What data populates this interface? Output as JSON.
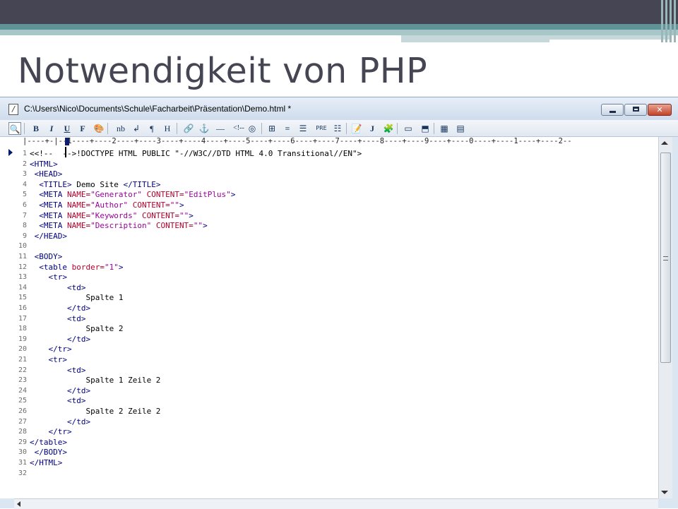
{
  "slide": {
    "title": "Notwendigkeit von PHP"
  },
  "window": {
    "title": "C:\\Users\\Nico\\Documents\\Schule\\Facharbeit\\Präsentation\\Demo.html *",
    "buttons": {
      "minimize": "minimize",
      "maximize": "maximize",
      "close": "✕"
    }
  },
  "toolbar": {
    "items": [
      {
        "name": "browser-preview-button",
        "label": "🔍",
        "icon": "preview-icon"
      },
      {
        "name": "bold-button",
        "label": "B"
      },
      {
        "name": "italic-button",
        "label": "I"
      },
      {
        "name": "underline-button",
        "label": "U"
      },
      {
        "name": "font-button",
        "label": "F"
      },
      {
        "name": "color-button",
        "label": "🎨",
        "icon": "palette-icon"
      },
      {
        "name": "nbsp-button",
        "label": "nb"
      },
      {
        "name": "line-break-button",
        "label": "↲"
      },
      {
        "name": "paragraph-button",
        "label": "¶"
      },
      {
        "name": "heading-button",
        "label": "H"
      },
      {
        "name": "link-button",
        "label": "🔗",
        "icon": "link-icon"
      },
      {
        "name": "anchor-button",
        "label": "⚓",
        "icon": "anchor-icon"
      },
      {
        "name": "horizontal-rule-button",
        "label": "—"
      },
      {
        "name": "comment-button",
        "label": "<!--"
      },
      {
        "name": "image-button",
        "label": "◎",
        "icon": "image-icon"
      },
      {
        "name": "table-button",
        "label": "⊞",
        "icon": "table-icon"
      },
      {
        "name": "center-button",
        "label": "≡",
        "icon": "align-center-icon"
      },
      {
        "name": "align-button",
        "label": "☰",
        "icon": "align-icon"
      },
      {
        "name": "pre-button",
        "label": "PRE"
      },
      {
        "name": "list-button",
        "label": "☷",
        "icon": "list-icon"
      },
      {
        "name": "form-button",
        "label": "📝",
        "icon": "form-icon"
      },
      {
        "name": "javascript-button",
        "label": "J"
      },
      {
        "name": "script-button",
        "label": "🧩",
        "icon": "script-icon"
      },
      {
        "name": "frame-button",
        "label": "▭",
        "icon": "frame-icon"
      },
      {
        "name": "frameset-button",
        "label": "⬒",
        "icon": "frameset-icon"
      },
      {
        "name": "color-picker-button",
        "label": "▦",
        "icon": "color-grid-icon"
      },
      {
        "name": "layout-button",
        "label": "▤",
        "icon": "layout-icon"
      }
    ]
  },
  "ruler": {
    "text": "|----+-|--1----+----2----+----3----+----4----+----5----+----6----+----7----+----8----+----9----+----0----+----1----+----2--"
  },
  "editor": {
    "lines": [
      {
        "n": "1",
        "parts": [
          [
            "txt",
            "<<!-- "
          ],
          [
            "txt",
            " -->!DOCTYPE HTML PUBLIC \"-//W3C//DTD HTML 4.0 Transitional//EN\">"
          ]
        ]
      },
      {
        "n": "2",
        "parts": [
          [
            "tag",
            "<HTML>"
          ]
        ]
      },
      {
        "n": "3",
        "parts": [
          [
            "tag",
            " <HEAD>"
          ]
        ]
      },
      {
        "n": "4",
        "parts": [
          [
            "tag",
            "  <TITLE>"
          ],
          [
            "txt",
            " Demo Site "
          ],
          [
            "tag",
            "</TITLE>"
          ]
        ]
      },
      {
        "n": "5",
        "parts": [
          [
            "tag",
            "  <META "
          ],
          [
            "attr",
            "NAME="
          ],
          [
            "val",
            "\"Generator\""
          ],
          [
            "attr",
            " CONTENT="
          ],
          [
            "val",
            "\"EditPlus\""
          ],
          [
            "tag",
            ">"
          ]
        ]
      },
      {
        "n": "6",
        "parts": [
          [
            "tag",
            "  <META "
          ],
          [
            "attr",
            "NAME="
          ],
          [
            "val",
            "\"Author\""
          ],
          [
            "attr",
            " CONTENT="
          ],
          [
            "val",
            "\"\""
          ],
          [
            "tag",
            ">"
          ]
        ]
      },
      {
        "n": "7",
        "parts": [
          [
            "tag",
            "  <META "
          ],
          [
            "attr",
            "NAME="
          ],
          [
            "val",
            "\"Keywords\""
          ],
          [
            "attr",
            " CONTENT="
          ],
          [
            "val",
            "\"\""
          ],
          [
            "tag",
            ">"
          ]
        ]
      },
      {
        "n": "8",
        "parts": [
          [
            "tag",
            "  <META "
          ],
          [
            "attr",
            "NAME="
          ],
          [
            "val",
            "\"Description\""
          ],
          [
            "attr",
            " CONTENT="
          ],
          [
            "val",
            "\"\""
          ],
          [
            "tag",
            ">"
          ]
        ]
      },
      {
        "n": "9",
        "parts": [
          [
            "tag",
            " </HEAD>"
          ]
        ]
      },
      {
        "n": "10",
        "parts": []
      },
      {
        "n": "11",
        "parts": [
          [
            "tag",
            " <BODY>"
          ]
        ]
      },
      {
        "n": "12",
        "parts": [
          [
            "tag",
            "  <table "
          ],
          [
            "attr",
            "border="
          ],
          [
            "val",
            "\"1\""
          ],
          [
            "tag",
            ">"
          ]
        ]
      },
      {
        "n": "13",
        "parts": [
          [
            "tag",
            "    <tr>"
          ]
        ]
      },
      {
        "n": "14",
        "parts": [
          [
            "tag",
            "        <td>"
          ]
        ]
      },
      {
        "n": "15",
        "parts": [
          [
            "txt",
            "            Spalte 1"
          ]
        ]
      },
      {
        "n": "16",
        "parts": [
          [
            "tag",
            "        </td>"
          ]
        ]
      },
      {
        "n": "17",
        "parts": [
          [
            "tag",
            "        <td>"
          ]
        ]
      },
      {
        "n": "18",
        "parts": [
          [
            "txt",
            "            Spalte 2"
          ]
        ]
      },
      {
        "n": "19",
        "parts": [
          [
            "tag",
            "        </td>"
          ]
        ]
      },
      {
        "n": "20",
        "parts": [
          [
            "tag",
            "    </tr>"
          ]
        ]
      },
      {
        "n": "21",
        "parts": [
          [
            "tag",
            "    <tr>"
          ]
        ]
      },
      {
        "n": "22",
        "parts": [
          [
            "tag",
            "        <td>"
          ]
        ]
      },
      {
        "n": "23",
        "parts": [
          [
            "txt",
            "            Spalte 1 Zeile 2"
          ]
        ]
      },
      {
        "n": "24",
        "parts": [
          [
            "tag",
            "        </td>"
          ]
        ]
      },
      {
        "n": "25",
        "parts": [
          [
            "tag",
            "        <td>"
          ]
        ]
      },
      {
        "n": "26",
        "parts": [
          [
            "txt",
            "            Spalte 2 Zeile 2"
          ]
        ]
      },
      {
        "n": "27",
        "parts": [
          [
            "tag",
            "        </td>"
          ]
        ]
      },
      {
        "n": "28",
        "parts": [
          [
            "tag",
            "    </tr>"
          ]
        ]
      },
      {
        "n": "29",
        "parts": [
          [
            "tag",
            "</table>"
          ]
        ]
      },
      {
        "n": "30",
        "parts": [
          [
            "tag",
            " </BODY>"
          ]
        ]
      },
      {
        "n": "31",
        "parts": [
          [
            "tag",
            "</HTML>"
          ]
        ]
      },
      {
        "n": "32",
        "parts": []
      }
    ]
  },
  "colors": {
    "slide_title": "#454553",
    "tag": "#000080",
    "attribute": "#b3002a",
    "value": "#9b009b"
  }
}
